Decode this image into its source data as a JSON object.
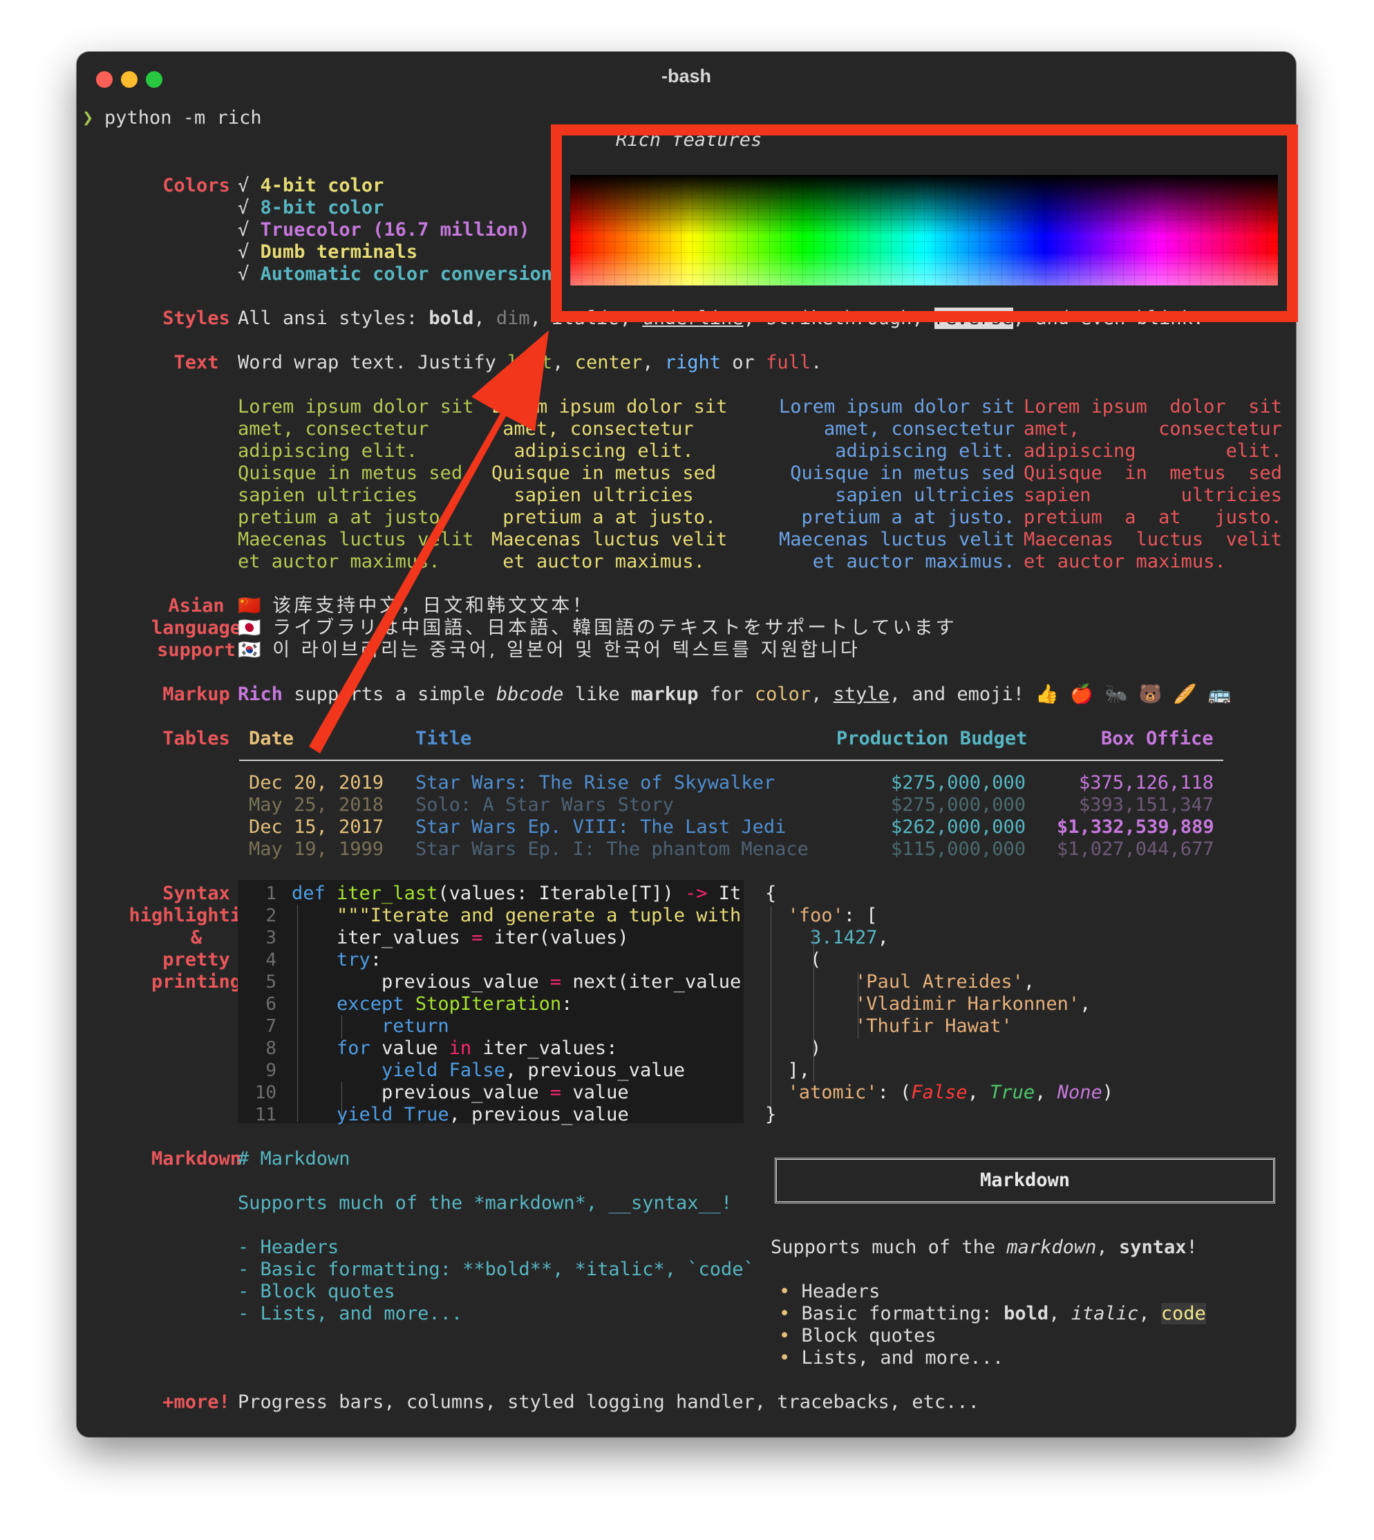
{
  "window": {
    "title": "-bash"
  },
  "prompt": {
    "symbol": "❯",
    "command": "python -m rich"
  },
  "panel_title": "Rich features",
  "sections": {
    "colors": "Colors",
    "styles": "Styles",
    "text": "Text",
    "asian": [
      "Asian",
      "language",
      "support"
    ],
    "markup": "Markup",
    "tables": "Tables",
    "syntax": [
      "Syntax",
      "highlighting",
      "&",
      "pretty",
      "printing"
    ],
    "markdown": "Markdown",
    "more": "+more!"
  },
  "colors": {
    "check": "√",
    "items": [
      "4-bit color",
      "8-bit color",
      "Truecolor (16.7 million)",
      "Dumb terminals",
      "Automatic color conversion"
    ]
  },
  "styles": {
    "prefix": "All ansi styles: ",
    "bold": "bold",
    "dim": "dim",
    "italic": "italic",
    "underline": "underline",
    "strike": "strikethrough",
    "reverse": "reverse",
    "suffix": ", and even blink."
  },
  "text": {
    "intro_a": "Word wrap text. Justify ",
    "left": "left",
    "center": "center",
    "right": "right",
    "or": " or ",
    "full": "full",
    "left_col": "Lorem ipsum dolor sit\namet, consectetur\nadipiscing elit.\nQuisque in metus sed\nsapien ultricies\npretium a at justo.\nMaecenas luctus velit\net auctor maximus.",
    "center_col": "Lorem ipsum dolor sit\n amet, consectetur \n  adipiscing elit.\nQuisque in metus sed\n  sapien ultricies \n pretium a at justo.\nMaecenas luctus velit\n et auctor maximus.",
    "right_col": "Lorem ipsum dolor sit\n    amet, consectetur\n     adipiscing elit.\n Quisque in metus sed\n     sapien ultricies\n  pretium a at justo.\nMaecenas luctus velit\n   et auctor maximus.",
    "full_col": "Lorem ipsum  dolor  sit\namet,       consectetur\nadipiscing        elit.\nQuisque  in  metus  sed\nsapien        ultricies\npretium  a  at   justo.\nMaecenas  luctus  velit\net auctor maximus."
  },
  "asian": {
    "lines": [
      {
        "flag": "🇨🇳",
        "text": "该库支持中文，日文和韩文文本！"
      },
      {
        "flag": "🇯🇵",
        "text": "ライブラリは中国語、日本語、韓国語のテキストをサポートしています"
      },
      {
        "flag": "🇰🇷",
        "text": "이 라이브러리는 중국어, 일본어 및 한국어 텍스트를 지원합니다"
      }
    ]
  },
  "markup": {
    "rich": "Rich",
    "a": " supports a simple ",
    "bbcode": "bbcode",
    "b": " like ",
    "markup": "markup",
    "c": " for ",
    "color": "color",
    "d": ", ",
    "style": "style",
    "e": ", and emoji! ",
    "emoji": "👍 🍎 🐜 🐻 🥖 🚌"
  },
  "table": {
    "headers": [
      "Date",
      "Title",
      "Production Budget",
      "Box Office"
    ],
    "rows": [
      [
        "Dec 20, 2019",
        "Star Wars: The Rise of Skywalker",
        "$275,000,000",
        "$375,126,118"
      ],
      [
        "May 25, 2018",
        "Solo: A Star Wars Story",
        "$275,000,000",
        "$393,151,347"
      ],
      [
        "Dec 15, 2017",
        "Star Wars Ep. VIII: The Last Jedi",
        "$262,000,000",
        "$1,332,539,889"
      ],
      [
        "May 19, 1999",
        "Star Wars Ep. I: The phantom Menace",
        "$115,000,000",
        "$1,027,044,677"
      ]
    ]
  },
  "code": {
    "line_numbers": [
      "1",
      "2",
      "3",
      "4",
      "5",
      "6",
      "7",
      "8",
      "9",
      "10",
      "11"
    ]
  },
  "pretty": {
    "open": "{",
    "key_foo": "'foo'",
    "colon_bracket": ": [",
    "num": "3.1427",
    "comma": ",",
    "paren_open": "(",
    "names": [
      "'Paul Atreides'",
      "'Vladimir Harkonnen'",
      "'Thufir Hawat'"
    ],
    "paren_close": ")",
    "bracket_close": "],",
    "key_atomic": "'atomic'",
    "false": "False",
    "true": "True",
    "none": "None",
    "close": "}"
  },
  "markdown": {
    "src": [
      "# Markdown",
      "",
      "Supports much of the *markdown*, __syntax__!",
      "",
      "- Headers",
      "- Basic formatting: **bold**, *italic*, `code`",
      "- Block quotes",
      "- Lists, and more..."
    ],
    "heading": "Markdown",
    "rendered_a": "Supports much of the ",
    "rendered_md": "markdown",
    "rendered_b": ", ",
    "rendered_syntax": "syntax",
    "rendered_c": "!",
    "bullet": "•",
    "items": [
      "Headers",
      "Block quotes",
      "Lists, and more..."
    ],
    "fmt_a": "Basic formatting: ",
    "fmt_bold": "bold",
    "fmt_sep": ", ",
    "fmt_italic": "italic",
    "fmt_code": "code"
  },
  "more": "Progress bars, columns, styled logging handler, tracebacks, etc...",
  "colors_theme": {
    "accent": "#e8565a",
    "highlight_box": "#f2361c"
  }
}
